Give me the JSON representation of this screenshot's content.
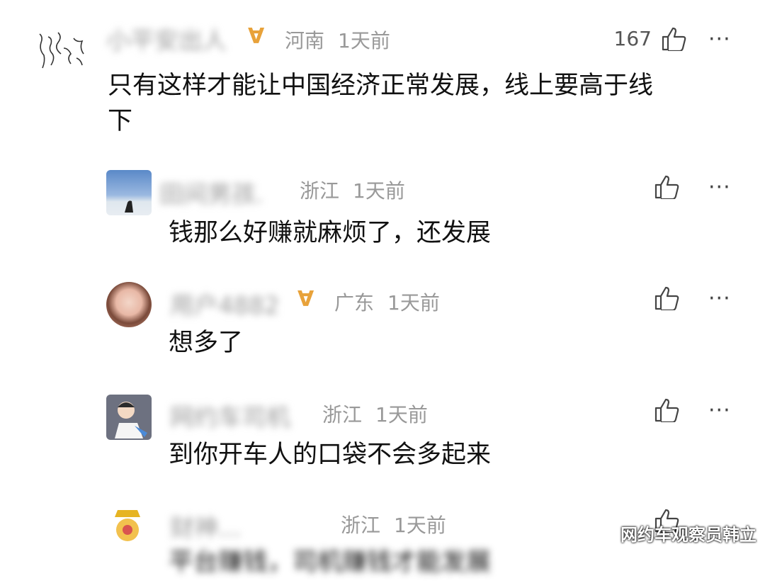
{
  "comments": [
    {
      "user": "小平安出人",
      "vip": "∀",
      "location": "河南",
      "time": "1天前",
      "likes": "167",
      "text_line1": "只有这样才能让中国经济正常发展，线上要高于线",
      "text_line2": "下"
    },
    {
      "user": "田间男孩.",
      "location": "浙江",
      "time": "1天前",
      "text": "钱那么好赚就麻烦了，还发展"
    },
    {
      "user": "用户4882",
      "vip": "∀",
      "location": "广东",
      "time": "1天前",
      "text": "想多了"
    },
    {
      "user": "网约车司机",
      "location": "浙江",
      "time": "1天前",
      "text": "到你开车人的口袋不会多起来"
    },
    {
      "user": "财神...",
      "location": "浙江",
      "time": "1天前",
      "text": "平台赚钱，司机赚钱才能发展"
    }
  ],
  "more_label": "···",
  "watermark": "网约车观察员韩立",
  "icons": {
    "like": "thumbs-up-icon",
    "more": "more-dots-icon",
    "vip": "vip-badge-icon"
  }
}
